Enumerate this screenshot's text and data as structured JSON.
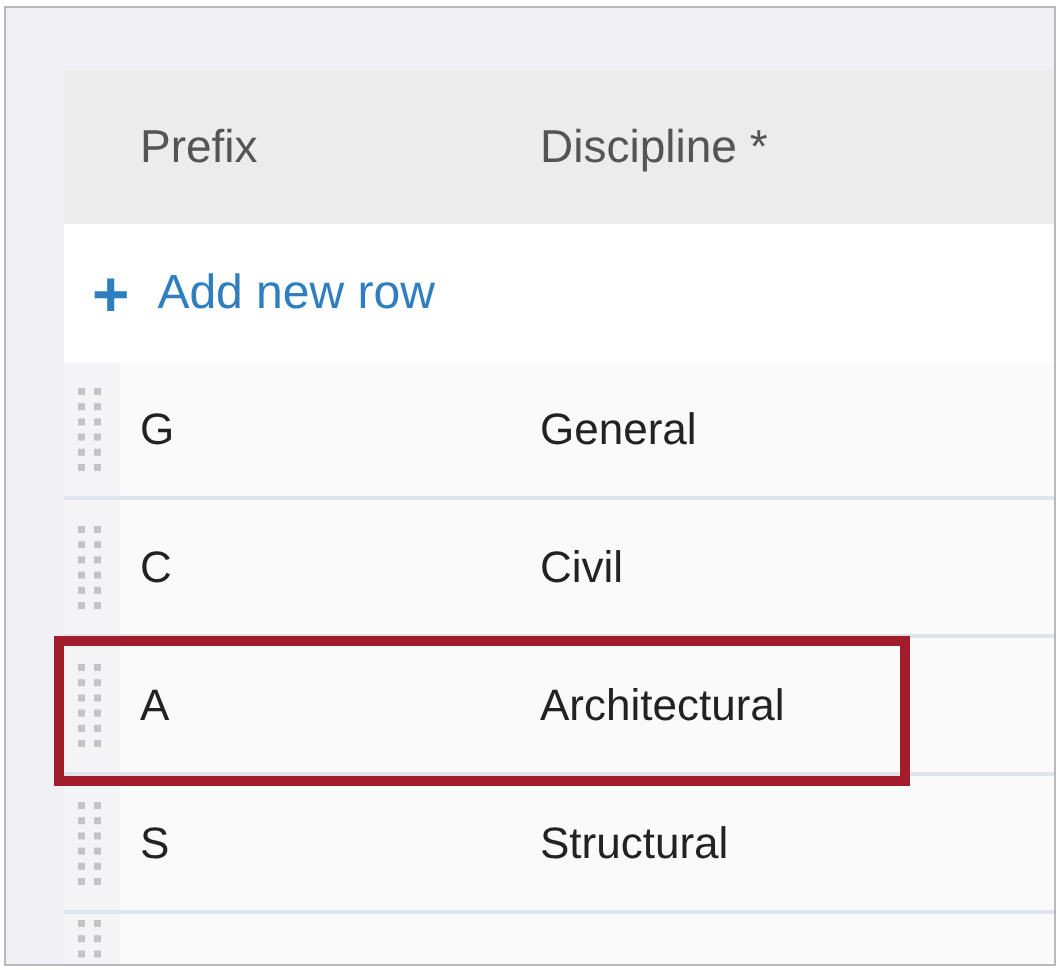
{
  "table": {
    "columns": [
      "Prefix",
      "Discipline *"
    ],
    "add_row": {
      "icon": "+",
      "label": "Add new row"
    },
    "rows": [
      {
        "prefix": "G",
        "discipline": "General",
        "highlighted": false
      },
      {
        "prefix": "C",
        "discipline": "Civil",
        "highlighted": false
      },
      {
        "prefix": "A",
        "discipline": "Architectural",
        "highlighted": true
      },
      {
        "prefix": "S",
        "discipline": "Structural",
        "highlighted": false
      }
    ]
  }
}
